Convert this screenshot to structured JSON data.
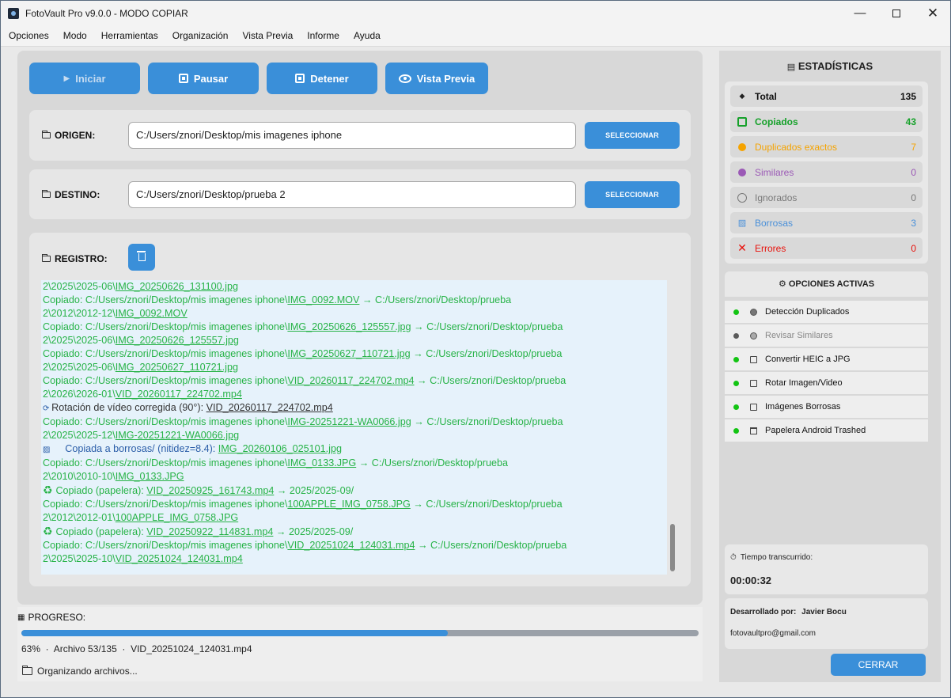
{
  "window": {
    "title": "FotoVault Pro v9.0.0 - MODO COPIAR"
  },
  "menu": [
    "Opciones",
    "Modo",
    "Herramientas",
    "Organización",
    "Vista Previa",
    "Informe",
    "Ayuda"
  ],
  "toolbar": {
    "start_label": "Iniciar",
    "pause_label": "Pausar",
    "stop_label": "Detener",
    "preview_label": "Vista Previa"
  },
  "origin": {
    "label": "ORIGEN:",
    "value": "C:/Users/znori/Desktop/mis imagenes iphone",
    "button": "SELECCIONAR"
  },
  "destination": {
    "label": "DESTINO:",
    "value": "C:/Users/znori/Desktop/prueba 2",
    "button": "SELECCIONAR"
  },
  "log": {
    "label": "REGISTRO:",
    "lines": [
      {
        "kind": "copy",
        "pre": "2\\2025\\2025-06\\",
        "link": "IMG_20250626_131100.jpg",
        "post": ""
      },
      {
        "kind": "copy",
        "pre": "Copiado: C:/Users/znori/Desktop/mis imagenes iphone\\",
        "link": "IMG_0092.MOV",
        "post": " → C:/Users/znori/Desktop/prueba"
      },
      {
        "kind": "copy",
        "pre": "2\\2012\\2012-12\\",
        "link": "IMG_0092.MOV",
        "post": ""
      },
      {
        "kind": "copy",
        "pre": "Copiado: C:/Users/znori/Desktop/mis imagenes iphone\\",
        "link": "IMG_20250626_125557.jpg",
        "post": " → C:/Users/znori/Desktop/prueba"
      },
      {
        "kind": "copy",
        "pre": "2\\2025\\2025-06\\",
        "link": "IMG_20250626_125557.jpg",
        "post": ""
      },
      {
        "kind": "copy",
        "pre": "Copiado: C:/Users/znori/Desktop/mis imagenes iphone\\",
        "link": "IMG_20250627_110721.jpg",
        "post": " → C:/Users/znori/Desktop/prueba"
      },
      {
        "kind": "copy",
        "pre": "2\\2025\\2025-06\\",
        "link": "IMG_20250627_110721.jpg",
        "post": ""
      },
      {
        "kind": "copy",
        "pre": "Copiado: C:/Users/znori/Desktop/mis imagenes iphone\\",
        "link": "VID_20260117_224702.mp4",
        "post": " → C:/Users/znori/Desktop/prueba"
      },
      {
        "kind": "copy",
        "pre": "2\\2026\\2026-01\\",
        "link": "VID_20260117_224702.mp4",
        "post": ""
      },
      {
        "kind": "info",
        "pre": "Rotación de vídeo corregida (90°): ",
        "link": "VID_20260117_224702.mp4",
        "post": ""
      },
      {
        "kind": "copy",
        "pre": "Copiado: C:/Users/znori/Desktop/mis imagenes iphone\\",
        "link": "IMG-20251221-WA0066.jpg",
        "post": " → C:/Users/znori/Desktop/prueba"
      },
      {
        "kind": "copy",
        "pre": "2\\2025\\2025-12\\",
        "link": "IMG-20251221-WA0066.jpg",
        "post": ""
      },
      {
        "kind": "blur",
        "pre": "Copiada a borrosas/ (nitidez=8.4): ",
        "link": "IMG_20260106_025101.jpg",
        "post": ""
      },
      {
        "kind": "copy",
        "pre": "Copiado: C:/Users/znori/Desktop/mis imagenes iphone\\",
        "link": "IMG_0133.JPG",
        "post": " → C:/Users/znori/Desktop/prueba"
      },
      {
        "kind": "copy",
        "pre": "2\\2010\\2010-10\\",
        "link": "IMG_0133.JPG",
        "post": ""
      },
      {
        "kind": "recycle",
        "pre": "Copiado (papelera): ",
        "link": "VID_20250925_161743.mp4",
        "post": " → 2025/2025-09/"
      },
      {
        "kind": "copy",
        "pre": "Copiado: C:/Users/znori/Desktop/mis imagenes iphone\\",
        "link": "100APPLE_IMG_0758.JPG",
        "post": " → C:/Users/znori/Desktop/prueba"
      },
      {
        "kind": "copy",
        "pre": "2\\2012\\2012-01\\",
        "link": "100APPLE_IMG_0758.JPG",
        "post": ""
      },
      {
        "kind": "recycle",
        "pre": "Copiado (papelera): ",
        "link": "VID_20250922_114831.mp4",
        "post": " → 2025/2025-09/"
      },
      {
        "kind": "copy",
        "pre": "Copiado: C:/Users/znori/Desktop/mis imagenes iphone\\",
        "link": "VID_20251024_124031.mp4",
        "post": " → C:/Users/znori/Desktop/prueba"
      },
      {
        "kind": "copy",
        "pre": "2\\2025\\2025-10\\",
        "link": "VID_20251024_124031.mp4",
        "post": ""
      }
    ]
  },
  "progress": {
    "label": "PROGRESO:",
    "percent": 63,
    "info": "63%  ·  Archivo 53/135  ·  VID_20251024_124031.mp4",
    "status": "Organizando archivos..."
  },
  "stats": {
    "title": "ESTADÍSTICAS",
    "rows": [
      {
        "label": "Total",
        "value": "135",
        "color": "#111111",
        "icon": "cube-icon"
      },
      {
        "label": "Copiados",
        "value": "43",
        "color": "#16a12a",
        "icon": "checkbox-icon"
      },
      {
        "label": "Duplicados exactos",
        "value": "7",
        "color": "#f5a300",
        "icon": "orange-dot-icon"
      },
      {
        "label": "Similares",
        "value": "0",
        "color": "#9b59b6",
        "icon": "purple-dot-icon"
      },
      {
        "label": "Ignorados",
        "value": "0",
        "color": "#7a7a7a",
        "icon": "circle-icon"
      },
      {
        "label": "Borrosas",
        "value": "3",
        "color": "#4a90d9",
        "icon": "blur-image-icon"
      },
      {
        "label": "Errores",
        "value": "0",
        "color": "#e8120c",
        "icon": "x-icon"
      }
    ]
  },
  "options": {
    "title": "OPCIONES ACTIVAS",
    "items": [
      {
        "label": "Detección Duplicados",
        "active": true
      },
      {
        "label": "Revisar Similares",
        "active": false
      },
      {
        "label": "Convertir HEIC a JPG",
        "active": true
      },
      {
        "label": "Rotar Imagen/Video",
        "active": true
      },
      {
        "label": "Imágenes Borrosas",
        "active": true
      },
      {
        "label": "Papelera Android Trashed",
        "active": true
      }
    ]
  },
  "timer": {
    "label": "Tiempo transcurrido:",
    "value": "00:00:32"
  },
  "developer": {
    "label": "Desarrollado por:",
    "name": "Javier Bocu",
    "email": "fotovaultpro@gmail.com"
  },
  "close_label": "CERRAR"
}
